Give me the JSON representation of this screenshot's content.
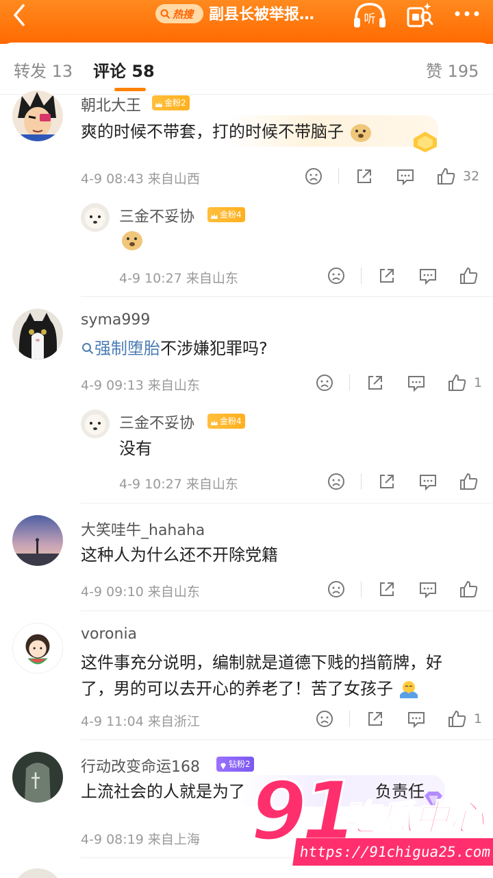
{
  "topbar": {
    "hot_label": "热搜",
    "title": "副县长被举报…",
    "listen_label": "听"
  },
  "tabs": {
    "forward": "转发 13",
    "comments": "评论 58",
    "likes": "赞 195"
  },
  "comments": [
    {
      "name": "朝北大王",
      "badge": "金粉2",
      "text": "爽的时候不带套，打的时候不带脑子",
      "meta": "4-9 08:43 来自山西",
      "likes": "32",
      "reply": {
        "name": "三金不妥协",
        "badge": "金粉4",
        "text": "",
        "meta": "4-9 10:27 来自山东"
      }
    },
    {
      "name": "syma999",
      "topic": "强制堕胎",
      "text": "不涉嫌犯罪吗?",
      "meta": "4-9 09:13 来自山东",
      "likes": "1",
      "reply": {
        "name": "三金不妥协",
        "badge": "金粉4",
        "text": "没有",
        "meta": "4-9 10:27 来自山东"
      }
    },
    {
      "name": "大笑哇牛_hahaha",
      "text": "这种人为什么还不开除党籍",
      "meta": "4-9 09:10 来自山东"
    },
    {
      "name": "voronia",
      "text_line1": "这件事充分说明，编制就是道德下贱的挡箭牌，好",
      "text_line2": "了，男的可以去开心的养老了！苦了女孩子",
      "meta": "4-9 11:04 来自浙江",
      "likes": "1"
    },
    {
      "name": "行动改变命运168",
      "badge": "钻粉2",
      "text": "上流社会的人就是为了",
      "text_tail": "负责任",
      "meta": "4-9 08:19 来自上海"
    }
  ],
  "watermark": {
    "number": "91",
    "name": "吃瓜中心",
    "url": "https://91chigua25.com"
  },
  "colors": {
    "accent": "#ff7a00",
    "topic": "#4c7db5",
    "gold_badge": "#ffb01f",
    "diamond_badge": "#8a64f7"
  }
}
